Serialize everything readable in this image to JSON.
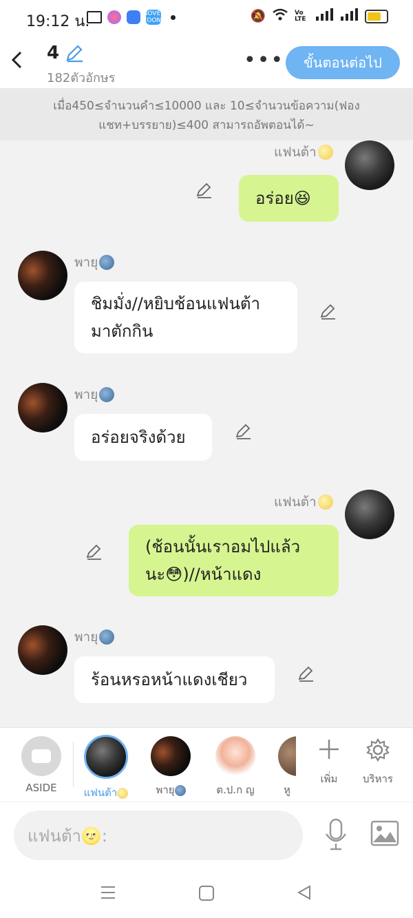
{
  "status_bar": {
    "time": "19:12 น.",
    "app_badge": "NOVEL TOON",
    "lte": "Vo LTE"
  },
  "header": {
    "chapter_number": "4",
    "char_count": "182ตัวอักษร",
    "more_label": "•••",
    "next_button": "ขั้นตอนต่อไป"
  },
  "notice": {
    "line1": "เมื่อ450≤จำนวนคำ≤10000 และ 10≤จำนวนข้อความ(ฟอง",
    "line2": "แชท+บรรยาย)≤400 สามารถอัพตอนได้~"
  },
  "messages": [
    {
      "speaker": "แฟนต้า",
      "text": "อร่อย😆",
      "side": "right"
    },
    {
      "speaker": "พายุ",
      "line1": "ชิมมั่ง//หยิบช้อนแฟนต้า",
      "line2": "มาตักกิน",
      "side": "left"
    },
    {
      "speaker": "พายุ",
      "text": "อร่อยจริงด้วย",
      "side": "left"
    },
    {
      "speaker": "แฟนต้า",
      "line1": "(ช้อนนั้นเราอมไปแล้ว",
      "line2": "นะ😳)//หน้าแดง",
      "side": "right"
    },
    {
      "speaker": "พายุ",
      "text": "ร้อนหรอหน้าแดงเชียว",
      "side": "left"
    }
  ],
  "cast_bar": {
    "aside": "ASIDE",
    "characters": [
      "แฟนต้า",
      "พายุ",
      "ต.ป.ก ญ",
      "หู"
    ],
    "add": "เพิ่ม",
    "manage": "บริหาร"
  },
  "input": {
    "placeholder": "แฟนต้า🌝:"
  },
  "colors": {
    "accent": "#6fb4f3",
    "right_bubble": "#d6f590",
    "left_bubble": "#ffffff",
    "background": "#f2f2f2"
  }
}
